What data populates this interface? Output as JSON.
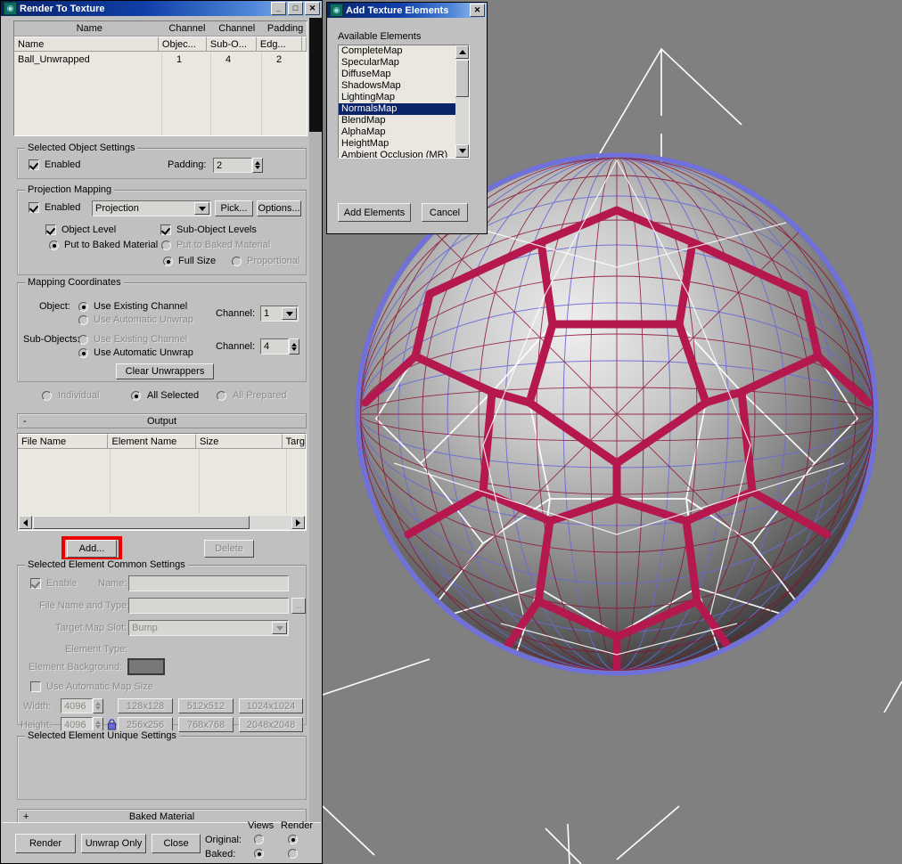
{
  "app": {
    "background_color": "#808080",
    "panel_color": "#c0c0c0",
    "accent_color": "#0a246a",
    "highlight_color": "#ee0000"
  },
  "rtt_window": {
    "title": "Render To Texture",
    "icon": "max-logo-icon",
    "buttons": {
      "minimize": "_",
      "maximize": "□",
      "close": "✕"
    },
    "object_list": {
      "group_headers": [
        "Name",
        "Channel",
        "Channel",
        "Padding"
      ],
      "columns": [
        "Name",
        "Objec...",
        "Sub-O...",
        "Edg...",
        ""
      ],
      "rows": [
        {
          "name": "Ball_Unwrapped",
          "object_channel": "1",
          "subobject_channel": "4",
          "edge_padding": "2"
        }
      ]
    },
    "selected_object_settings": {
      "legend": "Selected Object Settings",
      "enabled_label": "Enabled",
      "enabled_checked": true,
      "padding_label": "Padding:",
      "padding_value": "2"
    },
    "projection_mapping": {
      "legend": "Projection Mapping",
      "enabled_label": "Enabled",
      "enabled_checked": true,
      "modifier_value": "Projection",
      "pick_label": "Pick...",
      "options_label": "Options...",
      "object_level_label": "Object Level",
      "object_level_checked": true,
      "sub_object_levels_label": "Sub-Object Levels",
      "sub_object_levels_checked": true,
      "put_to_baked_material_left": "Put to Baked Material",
      "put_to_baked_material_left_selected": true,
      "put_to_baked_material_right": "Put to Baked Material",
      "put_to_baked_material_right_selected": false,
      "full_size_label": "Full Size",
      "full_size_selected": true,
      "proportional_label": "Proportional",
      "proportional_selected": false
    },
    "mapping_coordinates": {
      "legend": "Mapping Coordinates",
      "object_label": "Object:",
      "object_use_existing_channel": "Use Existing Channel",
      "object_use_existing_selected": true,
      "object_use_automatic_unwrap": "Use Automatic Unwrap",
      "object_use_automatic_selected": false,
      "object_channel_label": "Channel:",
      "object_channel_value": "1",
      "subobjects_label": "Sub-Objects:",
      "sub_use_existing_channel": "Use Existing Channel",
      "sub_use_existing_selected": false,
      "sub_use_automatic_unwrap": "Use Automatic Unwrap",
      "sub_use_automatic_selected": true,
      "sub_channel_label": "Channel:",
      "sub_channel_value": "4",
      "clear_unwrappers_label": "Clear Unwrappers"
    },
    "scope": {
      "individual_label": "Individual",
      "individual_selected": false,
      "all_selected_label": "All Selected",
      "all_selected_selected": true,
      "all_prepared_label": "All Prepared",
      "all_prepared_selected": false
    },
    "output": {
      "rollout_title": "Output",
      "rollout_toggle": "-",
      "columns": [
        "File Name",
        "Element Name",
        "Size",
        "Targ"
      ],
      "rows": [],
      "add_label": "Add...",
      "add_highlighted": true,
      "delete_label": "Delete",
      "delete_enabled": false
    },
    "element_common_settings": {
      "legend": "Selected Element Common Settings",
      "enable_label": "Enable",
      "enable_checked": true,
      "enable_disabled": true,
      "name_label": "Name:",
      "name_value": "",
      "file_name_and_type_label": "File Name and Type:",
      "file_name_and_type_value": "",
      "browse_label": "...",
      "target_map_slot_label": "Target Map Slot:",
      "target_map_slot_value": "Bump",
      "element_type_label": "Element Type:",
      "element_type_value": "",
      "element_background_label": "Element Background:",
      "element_background_color": "#787878",
      "use_automatic_map_size_label": "Use Automatic Map Size",
      "use_automatic_map_size_checked": false,
      "width_label": "Width:",
      "width_value": "4096",
      "height_label": "Height:",
      "height_value": "4096",
      "lock_icon": "padlock-icon",
      "size_presets": [
        "128x128",
        "512x512",
        "1024x1024",
        "256x256",
        "768x768",
        "2048x2048"
      ]
    },
    "element_unique_settings": {
      "legend": "Selected Element Unique Settings"
    },
    "baked_material_rollout": {
      "toggle": "+",
      "title": "Baked Material"
    },
    "footer": {
      "render_label": "Render",
      "unwrap_only_label": "Unwrap Only",
      "close_label": "Close",
      "views_header": "Views",
      "render_header": "Render",
      "original_label": "Original:",
      "original_views_selected": false,
      "original_render_selected": true,
      "baked_label": "Baked:",
      "baked_views_selected": true,
      "baked_render_selected": false
    }
  },
  "add_texture_elements_dialog": {
    "title": "Add Texture Elements",
    "icon": "max-logo-icon",
    "close_button": "✕",
    "available_elements_label": "Available Elements",
    "elements": [
      "CompleteMap",
      "SpecularMap",
      "DiffuseMap",
      "ShadowsMap",
      "LightingMap",
      "NormalsMap",
      "BlendMap",
      "AlphaMap",
      "HeightMap",
      "Ambient Occlusion (MR)"
    ],
    "selected_element": "NormalsMap",
    "selection_color": "#0a246a",
    "add_elements_label": "Add Elements",
    "cancel_label": "Cancel"
  },
  "viewport": {
    "background_color": "#808080",
    "object_name": "Ball_Unwrapped",
    "wireframe_color": "#ffffff",
    "projection_cage_color": "#6a6ad8",
    "seam_color": "#b5174f",
    "description": "Shaded soccer ball with projection cage and unwrap wireframe"
  }
}
